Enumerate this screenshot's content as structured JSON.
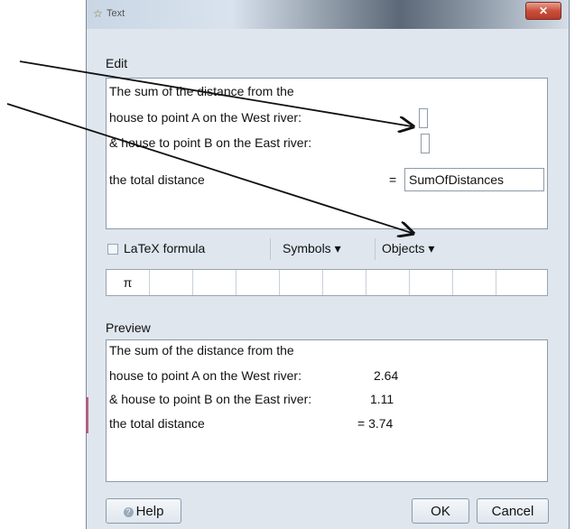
{
  "window": {
    "title": "Text",
    "close_label": "✕",
    "title_icon": "star-icon"
  },
  "edit": {
    "label": "Edit",
    "lines": [
      "The sum of the distance from the",
      "house to point A on the West river:",
      "& house to point B on the East river:",
      "the total distance"
    ],
    "equals": "=",
    "sum_field": "SumOfDistances"
  },
  "toolbar": {
    "latex_label": "LaTeX formula",
    "latex_checked": false,
    "symbols_label": "Symbols",
    "objects_label": "Objects",
    "dropdown_glyph": "▾"
  },
  "symbol_bar": {
    "first": "π"
  },
  "preview": {
    "label": "Preview",
    "lines": [
      {
        "text": "The sum of the distance from the",
        "value": ""
      },
      {
        "text": "house to point A on the West river:",
        "value": "2.64"
      },
      {
        "text": "& house to point B on the East river:",
        "value": "1.11"
      },
      {
        "text": "the total distance",
        "value": "= 3.74"
      }
    ]
  },
  "buttons": {
    "help": "Help",
    "ok": "OK",
    "cancel": "Cancel"
  },
  "annotation_arrows": {
    "color": "#111111",
    "count": 2
  }
}
